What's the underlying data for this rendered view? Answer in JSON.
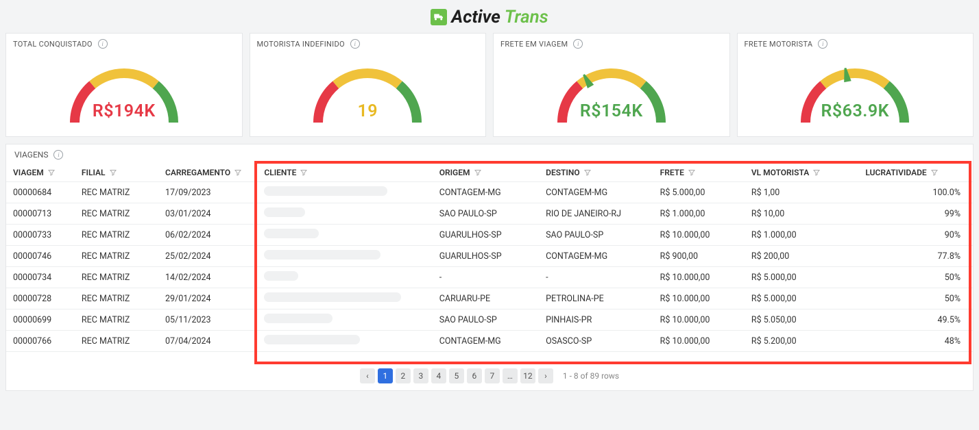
{
  "brand": {
    "part1": "Active",
    "part2": "Trans"
  },
  "kpis": [
    {
      "title": "TOTAL CONQUISTADO",
      "value": "R$194K",
      "color": "red",
      "needleAngle": -150
    },
    {
      "title": "MOTORISTA INDEFINIDO",
      "value": "19",
      "color": "yellow",
      "needleAngle": -143
    },
    {
      "title": "FRETE EM VIAGEM",
      "value": "R$154K",
      "color": "green",
      "needleAngle": -30
    },
    {
      "title": "FRETE MOTORISTA",
      "value": "R$63.9K",
      "color": "green",
      "needleAngle": -10
    }
  ],
  "tableTitle": "VIAGENS",
  "columns": {
    "viagem": "VIAGEM",
    "filial": "FILIAL",
    "carregamento": "CARREGAMENTO",
    "cliente": "CLIENTE",
    "origem": "ORIGEM",
    "destino": "DESTINO",
    "frete": "FRETE",
    "vl_motorista": "VL MOTORISTA",
    "lucratividade": "LUCRATIVIDADE"
  },
  "rows": [
    {
      "viagem": "00000684",
      "filial": "REC MATRIZ",
      "carregamento": "17/09/2023",
      "clienteRedactW": 180,
      "origem": "CONTAGEM-MG",
      "destino": "CONTAGEM-MG",
      "frete": "R$ 5.000,00",
      "vl": "R$ 1,00",
      "lucr": "100.0%"
    },
    {
      "viagem": "00000713",
      "filial": "REC MATRIZ",
      "carregamento": "03/01/2024",
      "clienteRedactW": 60,
      "origem": "SAO PAULO-SP",
      "destino": "RIO DE JANEIRO-RJ",
      "frete": "R$ 1.000,00",
      "vl": "R$ 10,00",
      "lucr": "99%"
    },
    {
      "viagem": "00000733",
      "filial": "REC MATRIZ",
      "carregamento": "06/02/2024",
      "clienteRedactW": 80,
      "origem": "GUARULHOS-SP",
      "destino": "SAO PAULO-SP",
      "frete": "R$ 10.000,00",
      "vl": "R$ 1.000,00",
      "lucr": "90%"
    },
    {
      "viagem": "00000746",
      "filial": "REC MATRIZ",
      "carregamento": "25/02/2024",
      "clienteRedactW": 170,
      "origem": "GUARULHOS-SP",
      "destino": "CONTAGEM-MG",
      "frete": "R$ 900,00",
      "vl": "R$ 200,00",
      "lucr": "77.8%"
    },
    {
      "viagem": "00000734",
      "filial": "REC MATRIZ",
      "carregamento": "14/02/2024",
      "clienteRedactW": 50,
      "origem": "-",
      "destino": "-",
      "frete": "R$ 10.000,00",
      "vl": "R$ 5.000,00",
      "lucr": "50%"
    },
    {
      "viagem": "00000728",
      "filial": "REC MATRIZ",
      "carregamento": "29/01/2024",
      "clienteRedactW": 200,
      "origem": "CARUARU-PE",
      "destino": "PETROLINA-PE",
      "frete": "R$ 10.000,00",
      "vl": "R$ 5.000,00",
      "lucr": "50%"
    },
    {
      "viagem": "00000699",
      "filial": "REC MATRIZ",
      "carregamento": "05/11/2023",
      "clienteRedactW": 100,
      "origem": "SAO PAULO-SP",
      "destino": "PINHAIS-PR",
      "frete": "R$ 10.000,00",
      "vl": "R$ 5.050,00",
      "lucr": "49.5%"
    },
    {
      "viagem": "00000766",
      "filial": "REC MATRIZ",
      "carregamento": "07/04/2024",
      "clienteRedactW": 140,
      "origem": "CONTAGEM-MG",
      "destino": "OSASCO-SP",
      "frete": "R$ 10.000,00",
      "vl": "R$ 5.200,00",
      "lucr": "48%"
    }
  ],
  "pager": {
    "pages": [
      "1",
      "2",
      "3",
      "4",
      "5",
      "6",
      "7"
    ],
    "last": "12",
    "active": "1",
    "info": "1 - 8 of 89 rows"
  }
}
